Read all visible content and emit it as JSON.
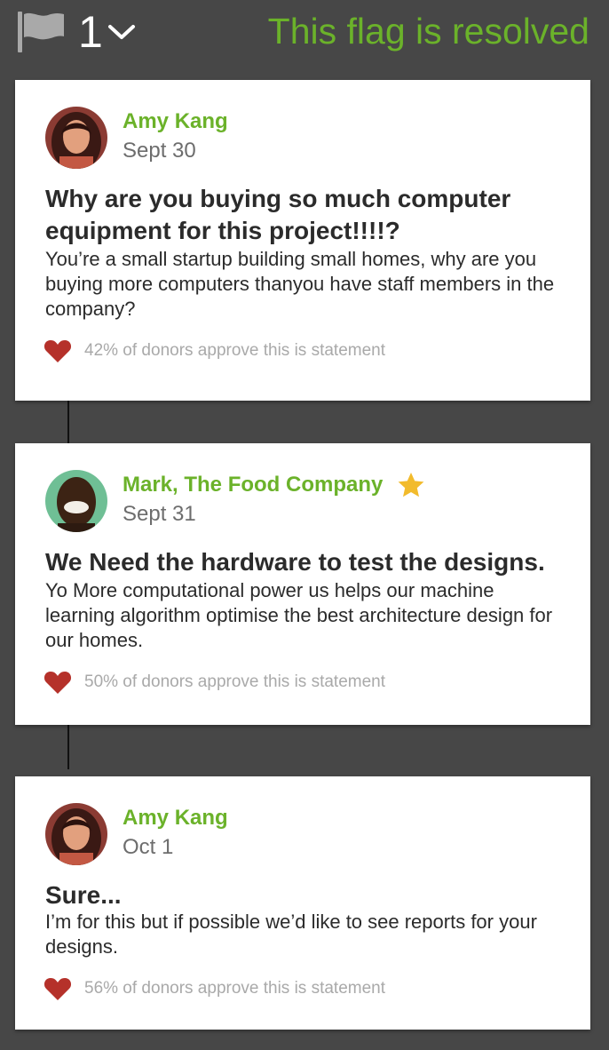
{
  "header": {
    "flag_count": "1",
    "status": "This flag is resolved",
    "flag_icon": "flag-icon",
    "dropdown_icon": "chevron-down-icon",
    "status_color": "#6bb22a"
  },
  "colors": {
    "background": "#474747",
    "accent": "#6bb22a",
    "heart": "#b5312a",
    "star": "#f2bb2c"
  },
  "comments": [
    {
      "author": "Amy Kang",
      "date": "Sept 30",
      "title": "Why are you buying so much computer equipment for this project!!!!?",
      "body": "You’re a small startup building small homes, why are you buying more computers thanyou have staff members in the company?",
      "approval": "42% of donors approve this is statement",
      "approval_percent": 42,
      "verified_icon": null
    },
    {
      "author": "Mark, The Food Company",
      "date": "Sept 31",
      "title": "We Need the hardware to test the designs.",
      "body": "Yo More computational power us helps our machine learning algorithm optimise the best architecture design for our homes.",
      "approval": "50% of donors approve this is statement",
      "approval_percent": 50,
      "verified_icon": "star-icon"
    },
    {
      "author": "Amy Kang",
      "date": "Oct 1",
      "title": "Sure...",
      "body": "I’m for this but if possible we’d like to see reports for your designs.",
      "approval": "56% of donors approve this is statement",
      "approval_percent": 56,
      "verified_icon": null
    }
  ]
}
